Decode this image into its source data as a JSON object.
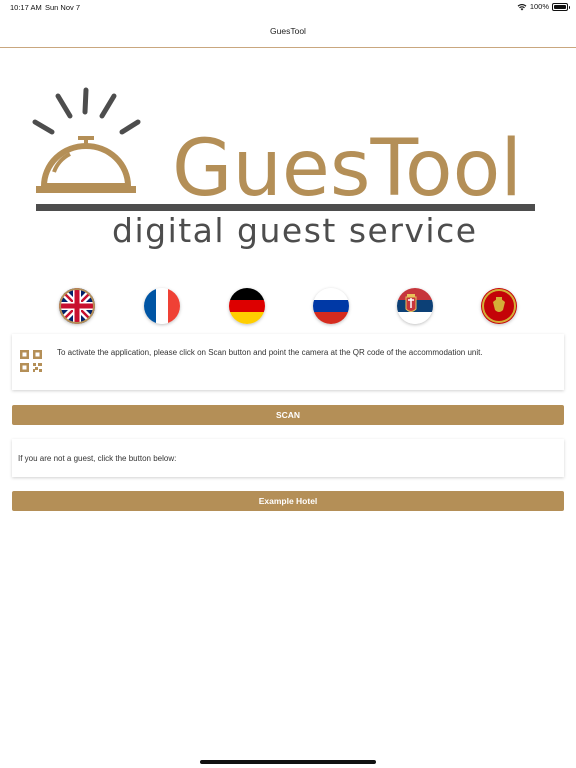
{
  "status_bar": {
    "time": "10:17 AM",
    "date": "Sun Nov 7",
    "battery_text": "100%",
    "battery_level": 1.0,
    "icons": [
      "wifi-icon",
      "battery-icon"
    ]
  },
  "nav": {
    "title": "GuesTool"
  },
  "logo": {
    "wordmark": "GuesTool",
    "tagline": "digital guest service",
    "brand_color": "#b48f57",
    "dark_color": "#4d4d4d"
  },
  "languages": [
    "English",
    "French",
    "German",
    "Russian",
    "Serbian",
    "Montenegrin"
  ],
  "info_card": {
    "icon": "qr-code-icon",
    "text": "To activate the application, please click on Scan button and point the camera at the QR code of the accommodation unit."
  },
  "scan_button": {
    "label": "SCAN"
  },
  "guest_card": {
    "text": "If you are not a guest, click the button below:"
  },
  "example_button": {
    "label": "Example Hotel"
  },
  "colors": {
    "accent": "#b48f57",
    "divider": "#c9a77f"
  }
}
